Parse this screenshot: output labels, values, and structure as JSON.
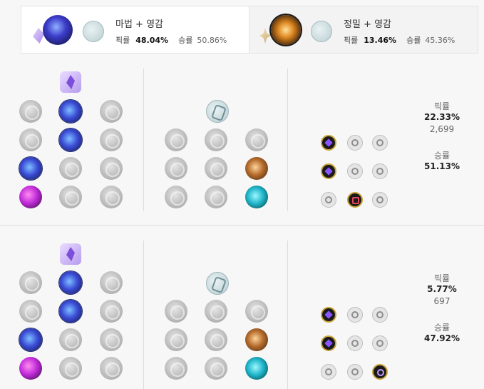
{
  "tabs": [
    {
      "title": "마법 + 영감",
      "pick_label": "픽률",
      "pick_value": "48.04%",
      "win_label": "승률",
      "win_value": "50.86%",
      "icon": "dark-harvest-blue-flame-icon"
    },
    {
      "title": "정밀 + 영감",
      "pick_label": "픽률",
      "pick_value": "13.46%",
      "win_label": "승률",
      "win_value": "45.36%",
      "icon": "precision-keystone-sun-icon"
    }
  ],
  "pages": [
    {
      "pick_label": "픽률",
      "pick_value": "22.33%",
      "games": "2,699",
      "win_label": "승률",
      "win_value": "51.13%"
    },
    {
      "pick_label": "픽률",
      "pick_value": "5.77%",
      "games": "697",
      "win_label": "승률",
      "win_value": "47.92%"
    }
  ],
  "colors": {
    "selected_border": "#c8a33a",
    "sorcery_purple": "#7d4ed9",
    "background": "#f7f7f7"
  }
}
